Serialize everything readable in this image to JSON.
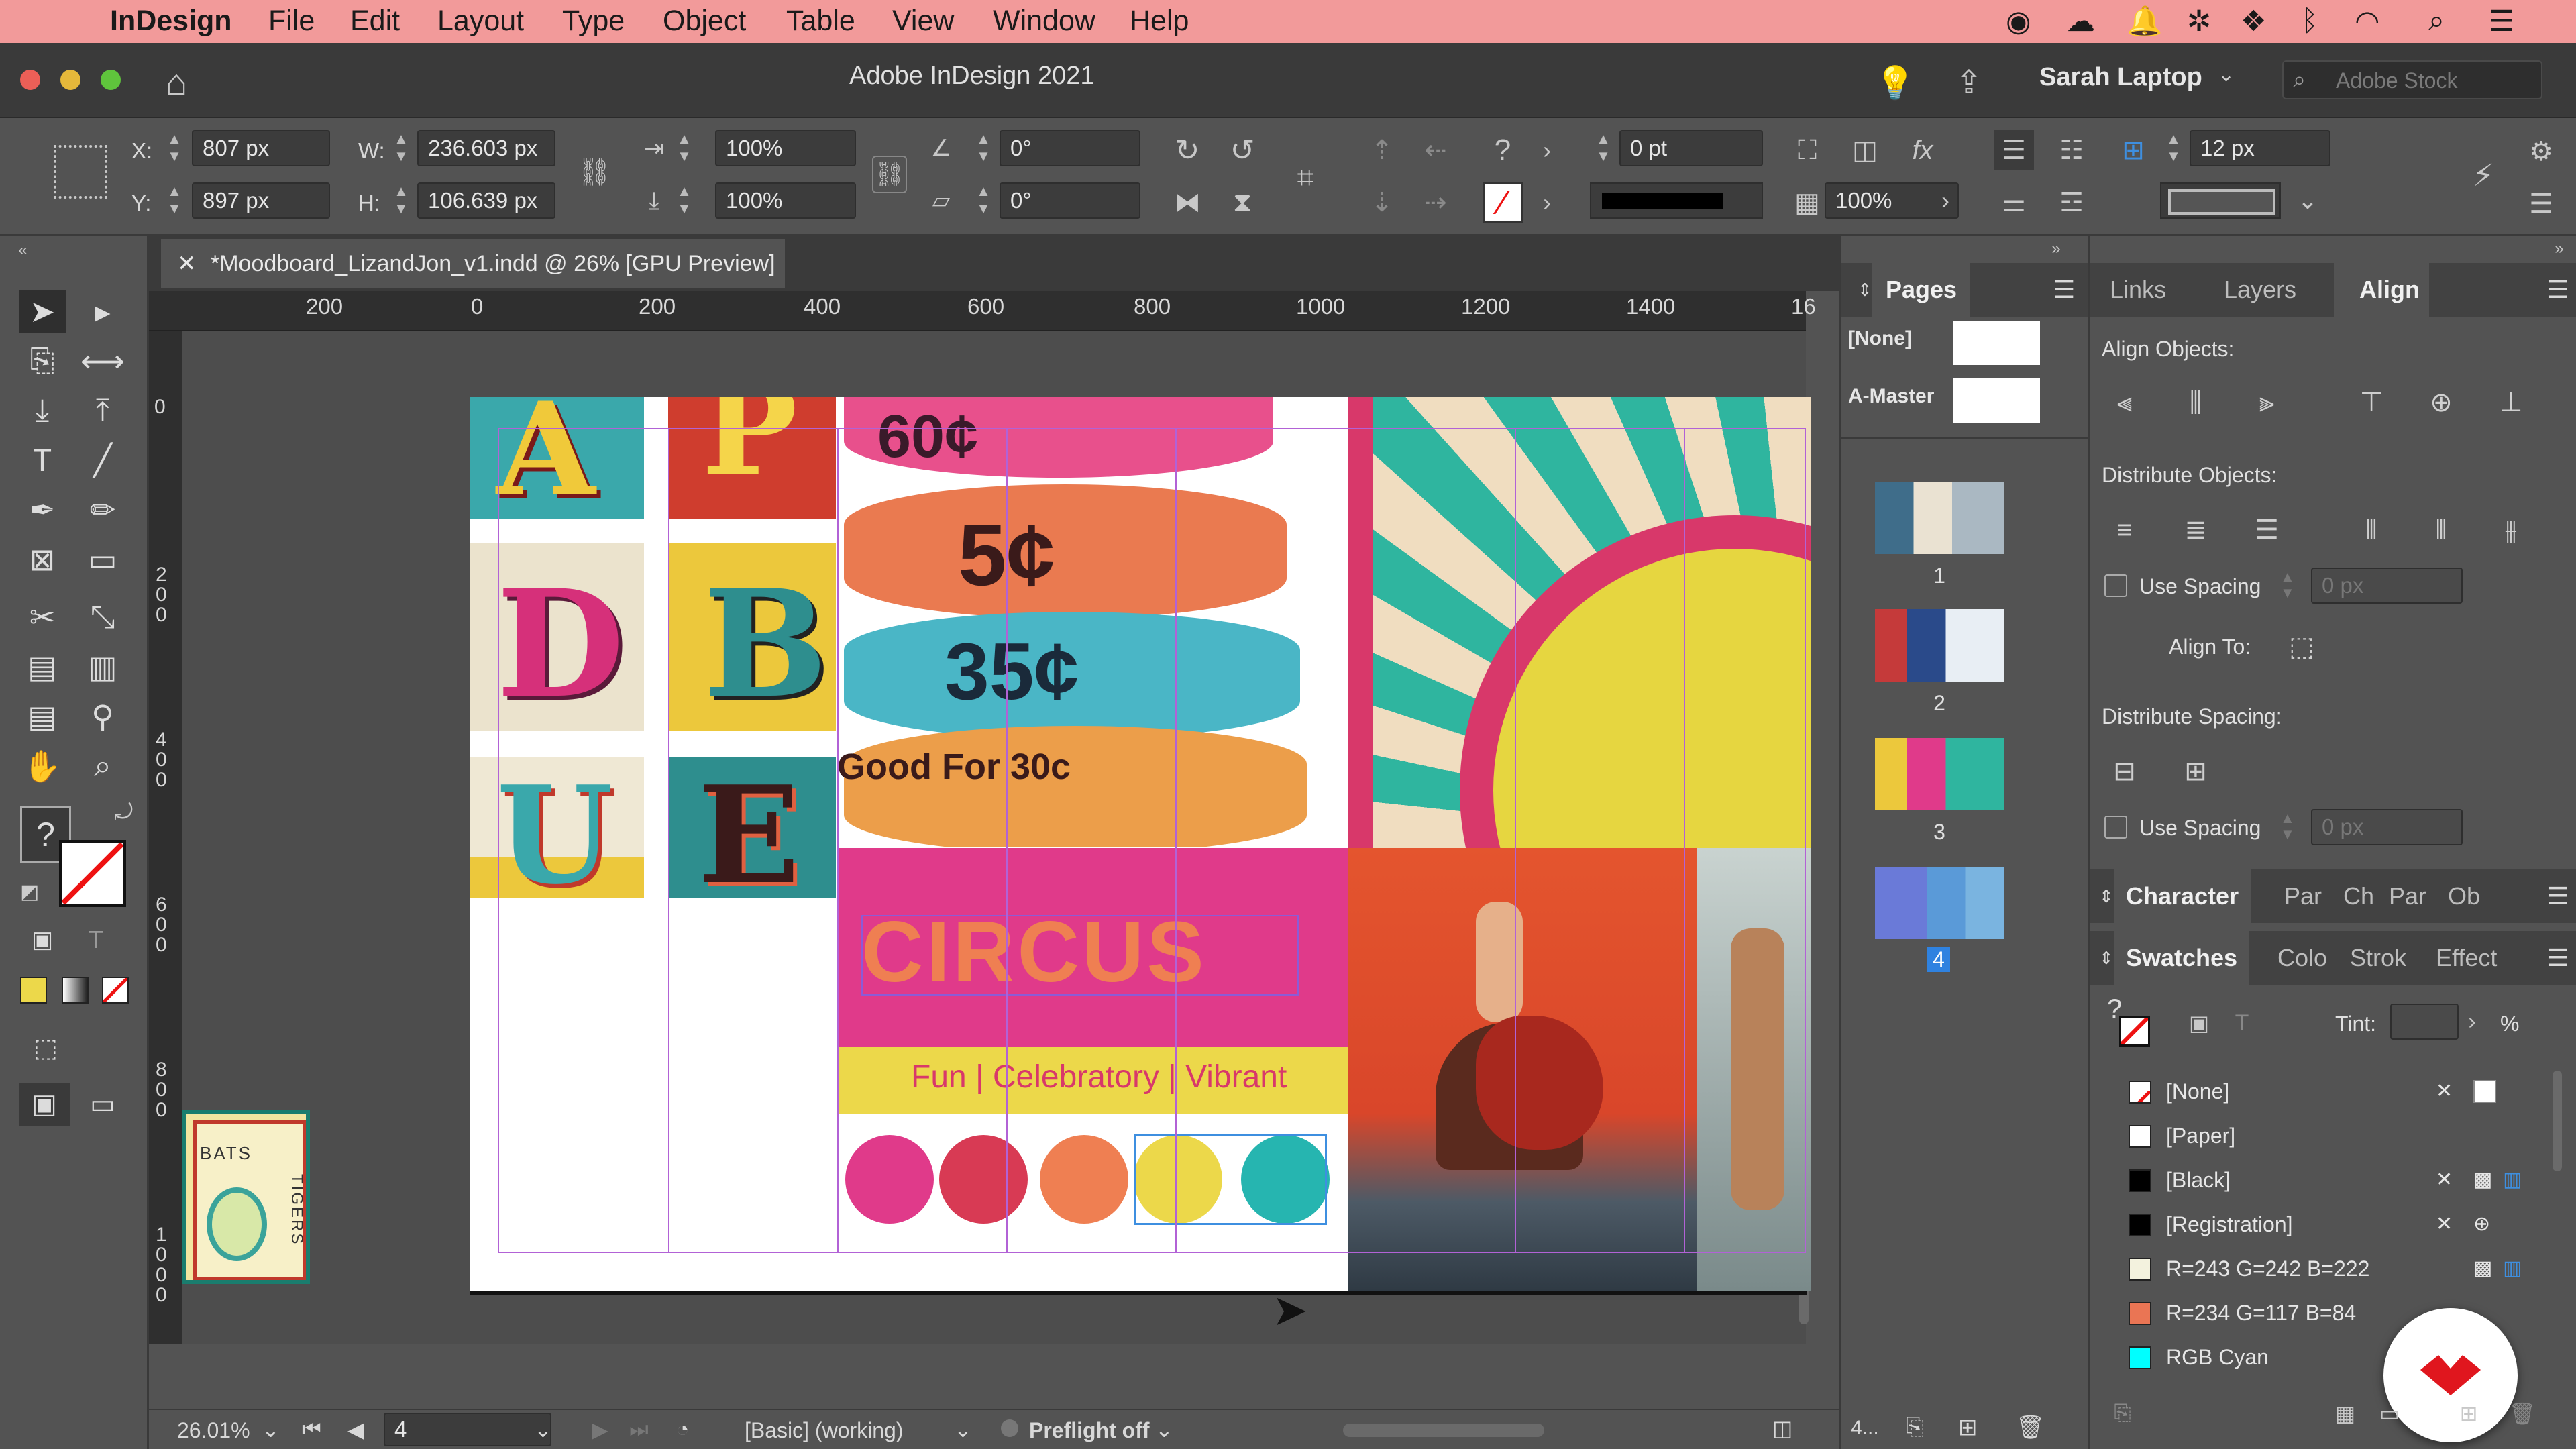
{
  "menubar": {
    "app_name": "InDesign",
    "items": [
      "File",
      "Edit",
      "Layout",
      "Type",
      "Object",
      "Table",
      "View",
      "Window",
      "Help"
    ]
  },
  "titlebar": {
    "title": "Adobe InDesign 2021",
    "user": "Sarah Laptop",
    "stock_placeholder": "Adobe Stock"
  },
  "control": {
    "x_label": "X:",
    "x_value": "807 px",
    "y_label": "Y:",
    "y_value": "897 px",
    "w_label": "W:",
    "w_value": "236.603 px",
    "h_label": "H:",
    "h_value": "106.639 px",
    "scale_x": "100%",
    "scale_y": "100%",
    "rotate": "0°",
    "shear": "0°",
    "stroke_weight": "0 pt",
    "opacity": "100%",
    "spacing": "12 px"
  },
  "document": {
    "tab_title": "*Moodboard_LizandJon_v1.indd @ 26% [GPU Preview]",
    "ruler_h": [
      "200",
      "0",
      "200",
      "400",
      "600",
      "800",
      "1000",
      "1200",
      "1400",
      "16"
    ],
    "ruler_v": [
      "0",
      "2 0 0",
      "4 0 0",
      "6 0 0",
      "8 0 0",
      "1 0 0 0"
    ],
    "circus_title": "CIRCUS",
    "circus_subtitle": "Fun | Celebratory | Vibrant",
    "tickets": [
      "60¢",
      "5¢",
      "35¢",
      "Good For 30c"
    ],
    "letters": [
      "A",
      "P",
      "D",
      "B",
      "U",
      "E"
    ],
    "pasteboard_text": [
      "BATS",
      "TIGERS"
    ]
  },
  "status": {
    "zoom": "26.01%",
    "page": "4",
    "style": "[Basic] (working)",
    "preflight": "Preflight off"
  },
  "pages_panel": {
    "title": "Pages",
    "masters": [
      "[None]",
      "A-Master"
    ],
    "pages": [
      "1",
      "2",
      "3",
      "4"
    ],
    "footer": "4..."
  },
  "right_panel": {
    "tabs": [
      "Links",
      "Layers",
      "Align"
    ],
    "align_objects": "Align Objects:",
    "distribute_objects": "Distribute Objects:",
    "use_spacing": "Use Spacing",
    "spacing_value": "0 px",
    "align_to": "Align To:",
    "distribute_spacing": "Distribute Spacing:",
    "char_tabs": [
      "Character",
      "Par",
      "Ch",
      "Par",
      "Ob"
    ],
    "swatch_tabs": [
      "Swatches",
      "Colo",
      "Strok",
      "Effect"
    ],
    "tint_label": "Tint:",
    "tint_unit": "%",
    "swatches": [
      {
        "name": "[None]",
        "color": "#ffffff"
      },
      {
        "name": "[Paper]",
        "color": "#ffffff"
      },
      {
        "name": "[Black]",
        "color": "#000000"
      },
      {
        "name": "[Registration]",
        "color": "#000000"
      },
      {
        "name": "R=243 G=242 B=222",
        "color": "#f3f2de"
      },
      {
        "name": "R=234 G=117 B=84",
        "color": "#ea7554"
      },
      {
        "name": "RGB Cyan",
        "color": "#00ffff"
      }
    ]
  },
  "colors": {
    "menubar": "#f29a9a",
    "magenta": "#e03a8a",
    "yellow": "#ecd84a",
    "orange": "#ef7f52",
    "teal": "#26b5b0",
    "selection": "#8c5bd6"
  }
}
